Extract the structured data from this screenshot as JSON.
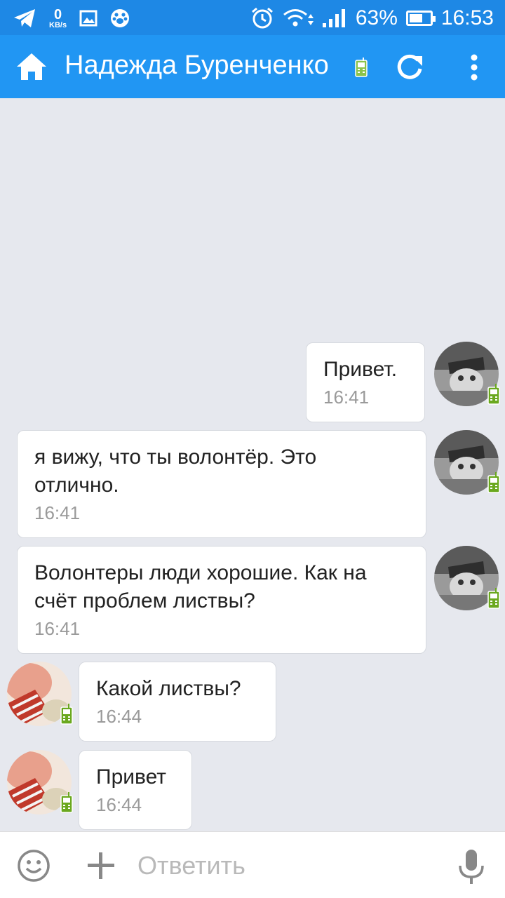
{
  "status_bar": {
    "net_speed": "0",
    "net_unit": "KB/s",
    "battery": "63%",
    "battery_level": 0.63,
    "time": "16:53"
  },
  "header": {
    "title": "Надежда Буренченко",
    "icons": [
      "home-icon",
      "mobile-phone-icon",
      "refresh-icon",
      "more-vertical-icon"
    ]
  },
  "messages": [
    {
      "text": "Привет.",
      "time": "16:41",
      "sender": "contact"
    },
    {
      "text": "я вижу, что ты волонтёр. Это отлично.",
      "time": "16:41",
      "sender": "contact"
    },
    {
      "text": "Волонтеры люди хорошие. Как на счёт проблем листвы?",
      "time": "16:41",
      "sender": "contact"
    },
    {
      "text": "Какой листвы?",
      "time": "16:44",
      "sender": "me"
    },
    {
      "text": "Привет",
      "time": "16:44",
      "sender": "me"
    }
  ],
  "input_bar": {
    "placeholder": "Ответить",
    "icons": [
      "smile-icon",
      "plus-icon",
      "microphone-icon"
    ]
  },
  "colors": {
    "status_bar": "#1e88e5",
    "app_bar": "#2196f3",
    "chat_background": "#e6e8ee",
    "mobile_badge": "#6aa81e"
  }
}
